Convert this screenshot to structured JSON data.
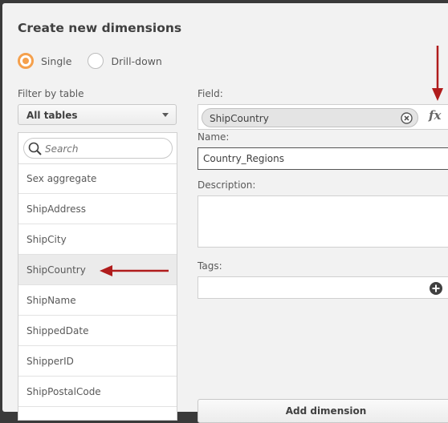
{
  "dialog": {
    "title": "Create new dimensions"
  },
  "mode": {
    "options": [
      {
        "label": "Single",
        "checked": true
      },
      {
        "label": "Drill-down",
        "checked": false
      }
    ]
  },
  "filter": {
    "label": "Filter by table",
    "selected": "All tables"
  },
  "search": {
    "placeholder": "Search"
  },
  "fields": {
    "items": [
      "Sex aggregate",
      "ShipAddress",
      "ShipCity",
      "ShipCountry",
      "ShipName",
      "ShippedDate",
      "ShipperID",
      "ShipPostalCode"
    ],
    "selected": "ShipCountry"
  },
  "form": {
    "field_label": "Field:",
    "field_value": "ShipCountry",
    "name_label": "Name:",
    "name_value": "Country_Regions",
    "description_label": "Description:",
    "description_value": "",
    "tags_label": "Tags:",
    "add_button": "Add dimension"
  },
  "colors": {
    "accent": "#f5a04c",
    "annotation_arrow": "#b01c1c"
  }
}
